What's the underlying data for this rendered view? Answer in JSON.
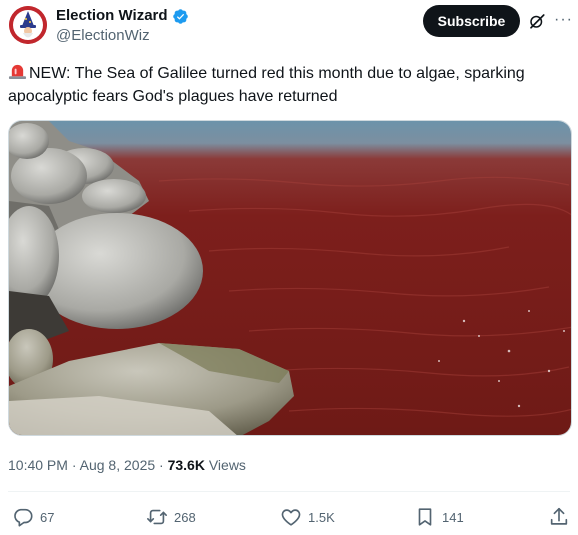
{
  "author": {
    "display_name": "Election Wizard",
    "handle": "@ElectionWiz",
    "verified": true
  },
  "header": {
    "subscribe_label": "Subscribe",
    "icons": [
      "grok-icon",
      "more-icon"
    ]
  },
  "tweet": {
    "text": "NEW: The Sea of Galilee turned red this month due to algae, sparking apocalyptic fears God's plagues have returned",
    "leading_emoji": "siren-emoji"
  },
  "meta": {
    "time": "10:40 PM",
    "separator": "·",
    "date": "Aug 8, 2025",
    "views_count": "73.6K",
    "views_label": "Views"
  },
  "actions": {
    "replies": "67",
    "reposts": "268",
    "likes": "1.5K",
    "bookmarks": "141"
  },
  "colors": {
    "text": "#0f1419",
    "secondary": "#536471",
    "verified": "#1d9bf0",
    "subscribe_bg": "#0f1419"
  }
}
